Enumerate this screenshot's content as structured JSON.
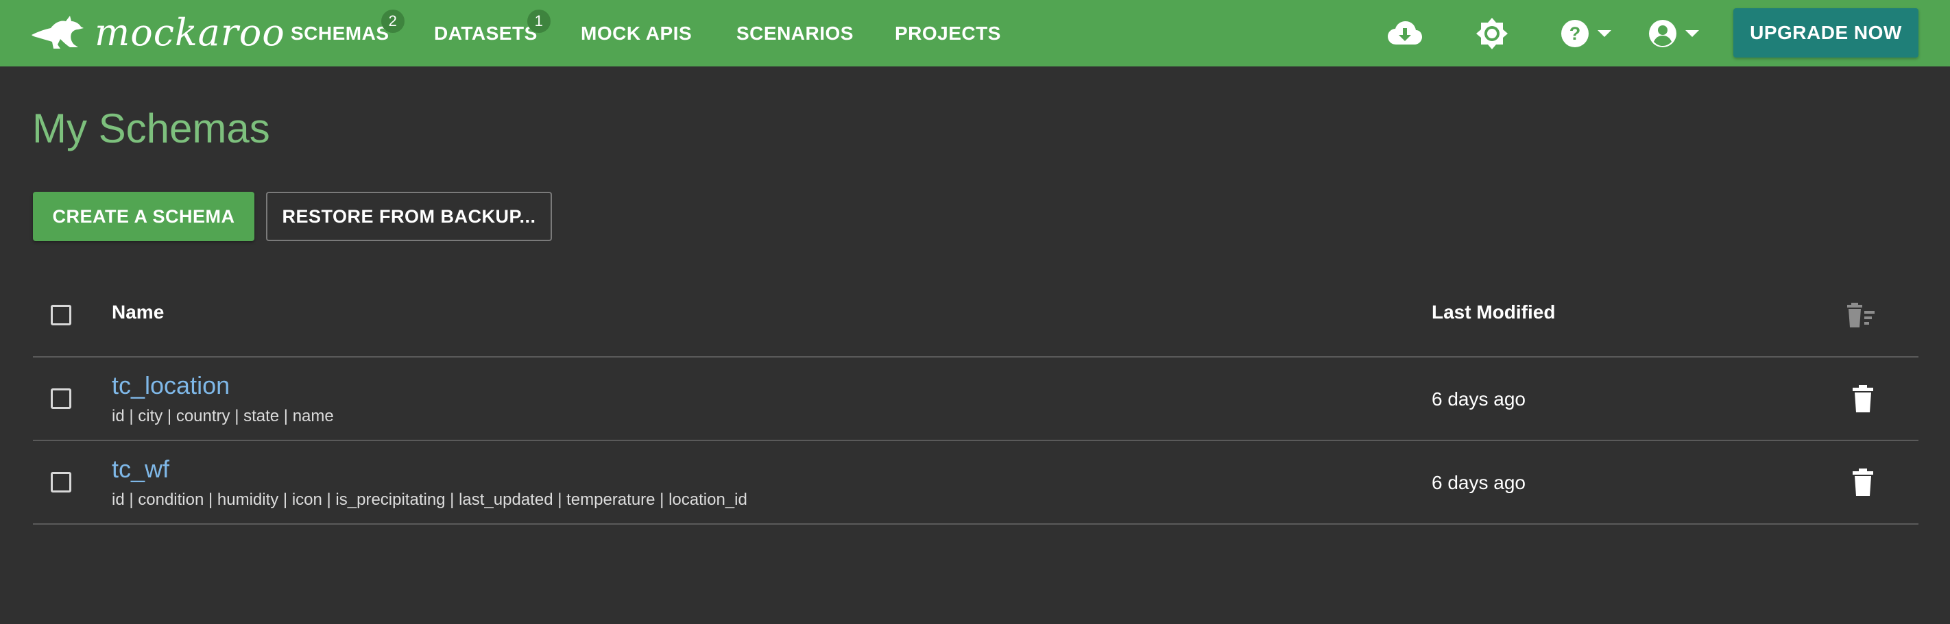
{
  "brand": {
    "logo_text": "mockaroo"
  },
  "nav": {
    "items": [
      {
        "label": "SCHEMAS",
        "badge": "2"
      },
      {
        "label": "DATASETS",
        "badge": "1"
      },
      {
        "label": "MOCK APIS"
      },
      {
        "label": "SCENARIOS"
      },
      {
        "label": "PROJECTS"
      }
    ],
    "icons": [
      "cloud-download-icon",
      "brightness-icon",
      "help-icon",
      "account-icon"
    ],
    "upgrade_label": "UPGRADE NOW"
  },
  "page": {
    "title": "My Schemas",
    "create_label": "CREATE A SCHEMA",
    "restore_label": "RESTORE FROM BACKUP..."
  },
  "table": {
    "columns": {
      "name": "Name",
      "modified": "Last Modified"
    },
    "rows": [
      {
        "name": "tc_location",
        "fields": "id | city | country | state | name",
        "modified": "6 days ago"
      },
      {
        "name": "tc_wf",
        "fields": "id | condition | humidity | icon | is_precipitating | last_updated | temperature | location_id",
        "modified": "6 days ago"
      }
    ]
  },
  "colors": {
    "topbar": "#52a552",
    "background": "#303030",
    "title": "#7dc07d",
    "link": "#7fb8e8",
    "upgrade": "#1f7f78"
  }
}
